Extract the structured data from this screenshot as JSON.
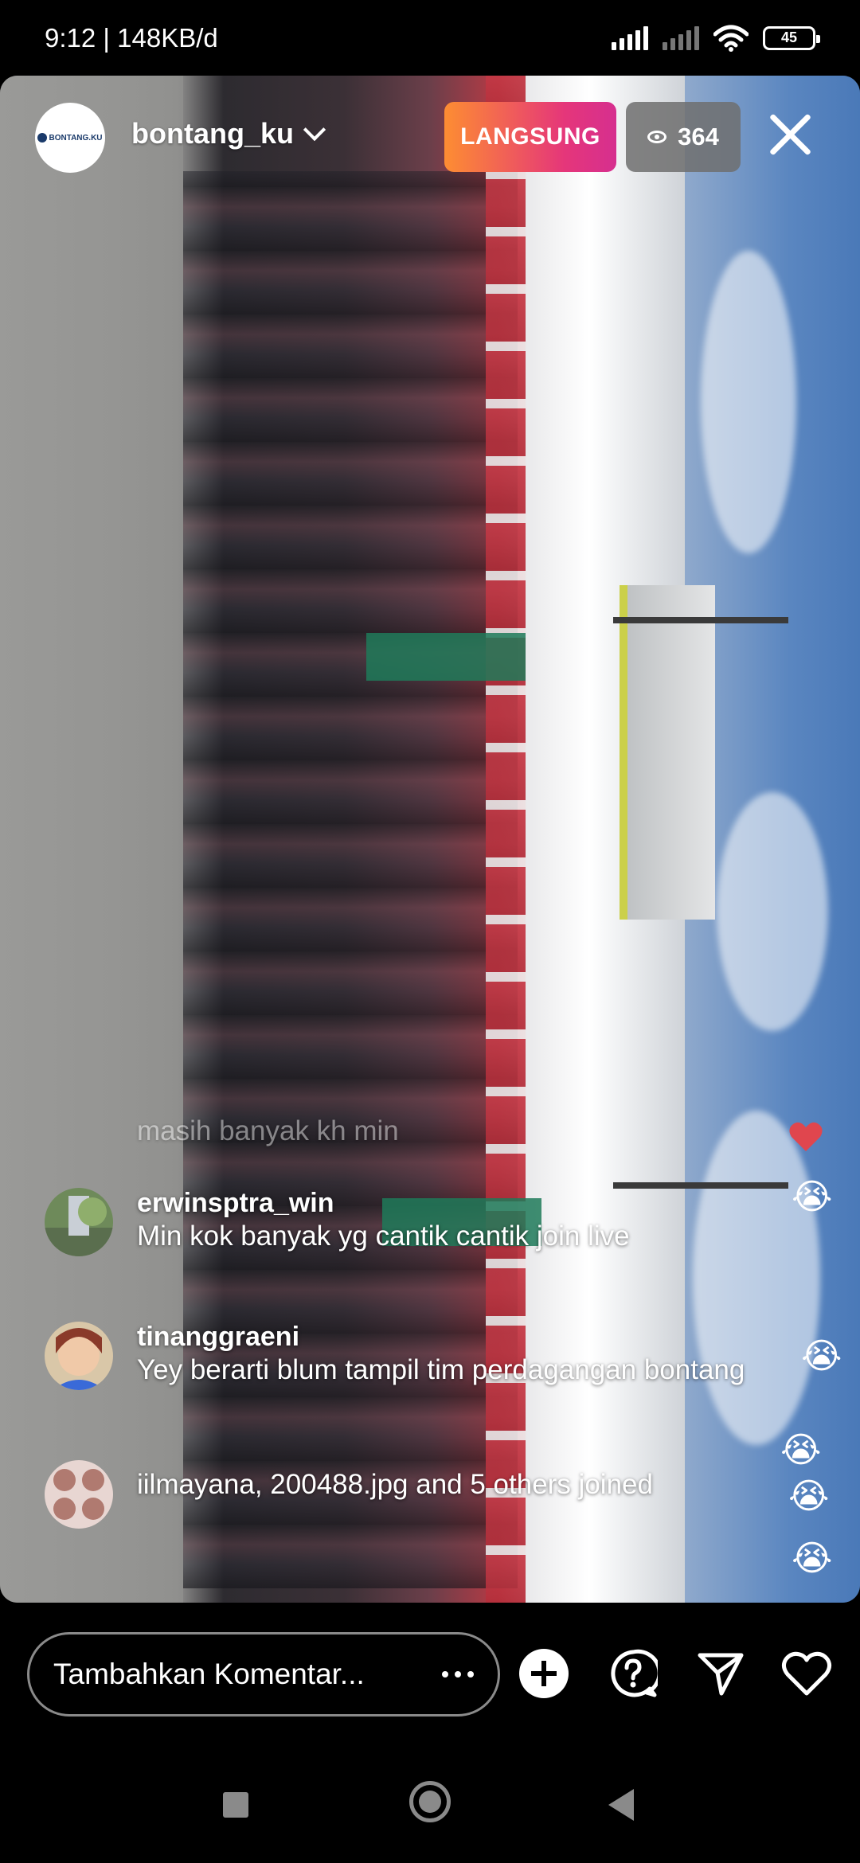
{
  "status_bar": {
    "time_speed": "9:12 | 148KB/d",
    "battery": "45"
  },
  "header": {
    "avatar_text": "BONTANG.KU",
    "username": "bontang_ku",
    "live_label": "LANGSUNG",
    "viewer_count": "364"
  },
  "comments": [
    {
      "username": "",
      "text": "masih banyak kh min",
      "faded": true
    },
    {
      "username": "erwinsptra_win",
      "text": "Min kok banyak yg cantik cantik join live"
    },
    {
      "username": "tinanggraeni",
      "text": "Yey berarti blum tampil tim perdagangan bontang"
    },
    {
      "username": "",
      "text": "iilmayana, 200488.jpg and 5 others joined"
    }
  ],
  "reactions": [
    "heart",
    "crying-face",
    "crying-face",
    "crying-face",
    "crying-face",
    "crying-face"
  ],
  "bottom_bar": {
    "comment_placeholder": "Tambahkan Komentar...",
    "icons": [
      "more-icon",
      "add-icon",
      "question-icon",
      "send-icon",
      "heart-icon"
    ]
  },
  "colors": {
    "live_gradient_start": "#fd8d32",
    "live_gradient_end": "#d62f8f",
    "viewer_badge": "#6e6e6e",
    "background": "#000000"
  }
}
